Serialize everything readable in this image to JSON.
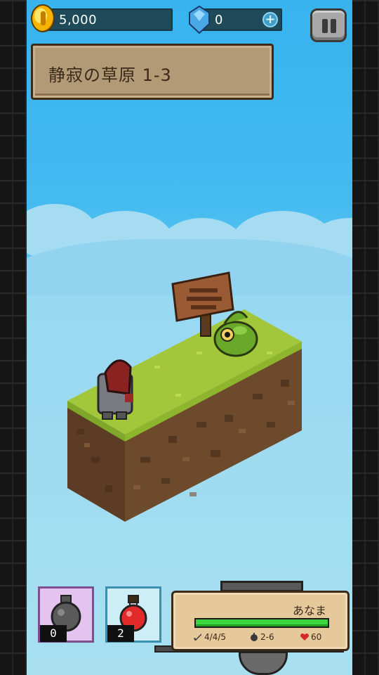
{
  "hud": {
    "coins": "5,000",
    "gems": "0",
    "icons": [
      "coin-icon",
      "gem-icon",
      "plus-icon",
      "pause-icon"
    ]
  },
  "stage": {
    "title": "静寂の草原 1-3"
  },
  "items": {
    "bomb_count": "0",
    "potion_count": "2"
  },
  "player": {
    "name": "あなま",
    "hp_fraction": 1.0,
    "attack": "4/4/5",
    "damage": "2-6",
    "hp": "60"
  },
  "colors": {
    "sky": "#44baf0",
    "hp_bar": "#3ed43e",
    "grass": "#a3c73a",
    "dirt": "#6e4a2c"
  }
}
